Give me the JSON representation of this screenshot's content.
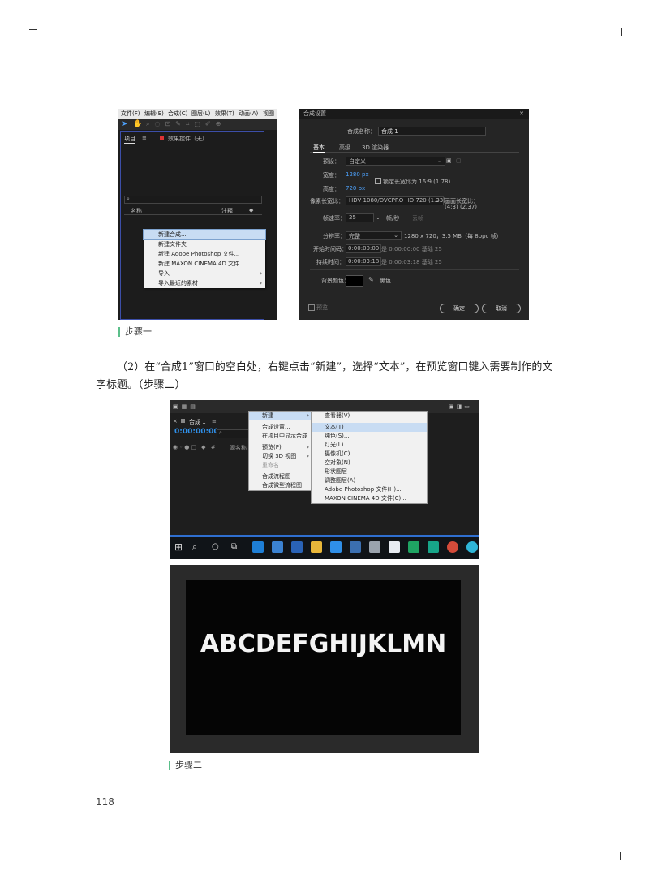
{
  "screenshot1": {
    "menubar": [
      "文件(F)",
      "编辑(E)",
      "合成(C)",
      "图层(L)",
      "效果(T)",
      "动画(A)",
      "视图"
    ],
    "panel_tab": "项目",
    "panel_tab2": "效果控件（无）",
    "col_name": "名称",
    "col_comment": "注释",
    "context_menu": [
      "新建合成...",
      "新建文件夹",
      "新建 Adobe Photoshop 文件...",
      "新建 MAXON CINEMA 4D 文件...",
      "导入",
      "导入最近的素材"
    ]
  },
  "caption1": "步骤一",
  "screenshot2": {
    "title": "合成设置",
    "name_label": "合成名称：",
    "name_value": "合成 1",
    "tabs": [
      "基本",
      "高级",
      "3D 渲染器"
    ],
    "preset_label": "预设：",
    "preset_value": "自定义",
    "width_label": "宽度：",
    "width_value": "1280 px",
    "height_label": "高度：",
    "height_value": "720 px",
    "lock_label": "锁定长宽比为 16:9 (1.78)",
    "pixel_aspect_label": "像素长宽比：",
    "pixel_aspect_value": "HDV 1080/DVCPRO HD 720 (1.33)",
    "frame_aspect_label": "画面长宽比：",
    "frame_aspect_value": "(4:3) (2.37)",
    "fps_label": "帧速率：",
    "fps_value": "25",
    "fps_unit": "帧/秒",
    "fps_drop": "丢帧",
    "res_label": "分辨率：",
    "res_value": "完整",
    "res_info": "1280 x 720，3.5 MB（每 8bpc 帧）",
    "start_label": "开始时间码：",
    "start_value": "0:00:00:00",
    "start_note": "是 0:00:00:00  基础 25",
    "dur_label": "持续时间：",
    "dur_value": "0:00:03:18",
    "dur_note": "是 0:00:03:18  基础 25",
    "bg_label": "背景颜色：",
    "bg_name": "黑色",
    "preview": "预览",
    "ok": "确定",
    "cancel": "取消"
  },
  "paragraph": "（2）在“合成1”窗口的空白处，右键点击“新建”，选择“文本”，在预览窗口键入需要制作的文字标题。（步骤二）",
  "screenshot3": {
    "comp_tab": "合成 1",
    "timecode": "0:00:00:00",
    "left_menu": [
      "新建",
      "合成设置...",
      "在项目中显示合成",
      "预览(P)",
      "切换 3D 视图",
      "重命名",
      "合成流程图",
      "合成微型流程图"
    ],
    "submenu": [
      "查看器(V)",
      "文本(T)",
      "纯色(S)...",
      "灯光(L)...",
      "摄像机(C)...",
      "空对象(N)",
      "形状图层",
      "调整图层(A)",
      "Adobe Photoshop 文件(H)...",
      "MAXON CINEMA 4D 文件(C)..."
    ],
    "col_label": "源名称"
  },
  "screenshot4": {
    "text": "ABCDEFGHIJKLMN"
  },
  "caption2": "步骤二",
  "page_number": "118",
  "colors": {
    "ae_dark": "#232323",
    "menu_highlight": "#c8dcf3",
    "accent_blue": "#2f8fe8",
    "caption_bar": "#5bbf8a"
  }
}
